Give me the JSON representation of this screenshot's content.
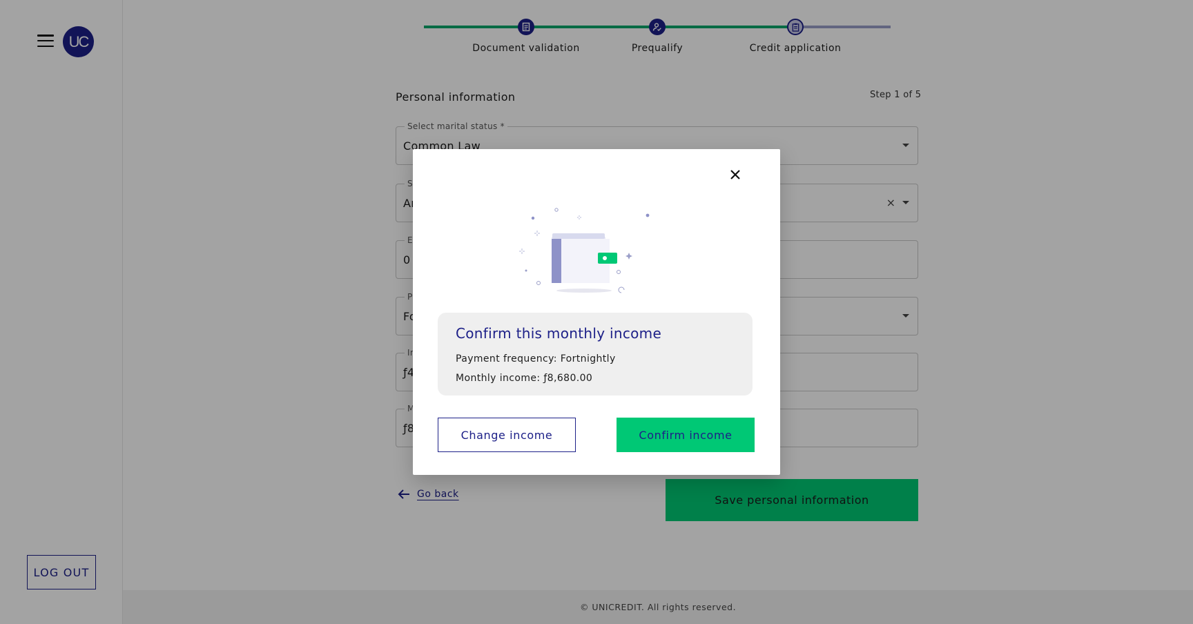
{
  "sidebar": {
    "avatar_text": "UC",
    "logout_label": "LOG OUT"
  },
  "stepper": {
    "steps": [
      {
        "label": "Document validation",
        "status": "done",
        "icon": "document-icon"
      },
      {
        "label": "Prequalify",
        "status": "done",
        "icon": "user-check-icon"
      },
      {
        "label": "Credit application",
        "status": "current",
        "icon": "clipboard-icon"
      }
    ]
  },
  "form": {
    "section_title": "Personal information",
    "step_count": "Step 1 of 5",
    "fields": [
      {
        "label": "Select marital status *",
        "value": "Common Law"
      },
      {
        "label": "Se",
        "value": "Ar"
      },
      {
        "label": "E",
        "value": "0"
      },
      {
        "label": "P",
        "value": "Fo"
      },
      {
        "label": "In",
        "value": "ƒ4"
      },
      {
        "label": "M",
        "value": "ƒ8"
      }
    ],
    "go_back_label": "Go back",
    "save_label": "Save personal information"
  },
  "modal": {
    "title": "Confirm this monthly income",
    "payment_frequency_line": "Payment frequency: Fortnightly",
    "monthly_income_line": "Monthly income: ƒ8,680.00",
    "change_label": "Change income",
    "confirm_label": "Confirm income"
  },
  "footer": {
    "text": "© UNICREDIT. All rights reserved."
  },
  "colors": {
    "brand_navy": "#1d2088",
    "brand_green": "#00c875",
    "progress_green": "#00a86b",
    "overlay": "rgba(0,0,0,0.36)"
  }
}
